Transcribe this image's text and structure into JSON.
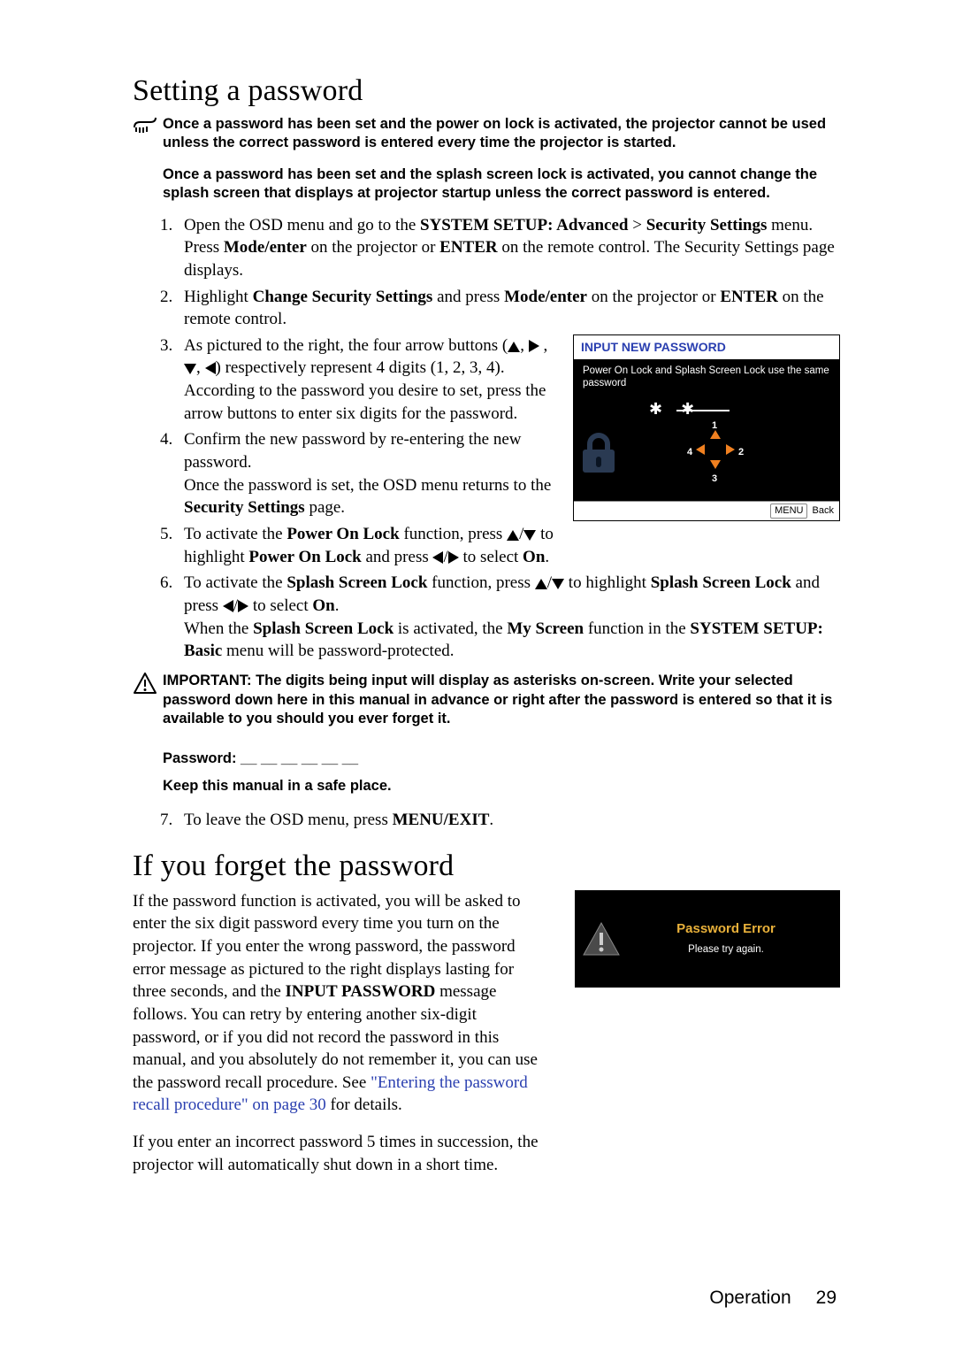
{
  "section1": {
    "title": "Setting a password",
    "notice1": "Once a password has been set and the power on lock is activated, the projector cannot be used unless the correct password is entered every time the projector is started.",
    "notice2": "Once a password has been set and the splash screen lock is activated, you cannot change the splash screen that displays at projector startup unless the correct password is entered.",
    "steps": {
      "s1": {
        "a": "Open the OSD menu and go to the ",
        "b1": "SYSTEM SETUP: Advanced",
        "gt": " > ",
        "b2": "Security Settings",
        "c": " menu. Press ",
        "b3": "Mode/enter",
        "d": " on the projector or ",
        "b4": "ENTER",
        "e": " on the remote control. The Security Settings page displays."
      },
      "s2": {
        "a": "Highlight ",
        "b1": "Change Security Settings",
        "b": " and press ",
        "b2": "Mode/enter",
        "c": " on the projector or ",
        "b3": "ENTER",
        "d": " on the remote control."
      },
      "s3": {
        "a": "As pictured to the right, the four arrow buttons (",
        "b": ") respectively represent 4 digits (1, 2, 3, 4). According to the password you desire to set, press the arrow buttons to enter six digits for the password."
      },
      "s4": {
        "a": "Confirm the new password by re-entering the new password.",
        "b": "Once the password is set, the OSD menu returns to the ",
        "c": "Security Settings",
        "d": " page."
      },
      "s5": {
        "a": "To activate the ",
        "b1": "Power On Lock",
        "b": " function, press ",
        "c": " to highlight ",
        "b2": "Power On Lock",
        "d": " and press ",
        "e": " to select ",
        "b3": "On",
        "f": "."
      },
      "s6": {
        "a": "To activate the ",
        "b1": "Splash Screen Lock",
        "b": " function, press ",
        "c": " to highlight ",
        "b2": "Splash Screen Lock",
        "d": " and press ",
        "e": " to select ",
        "b3": "On",
        "f": ".",
        "g": "When the ",
        "b4": "Splash Screen Lock",
        "h": " is activated, the ",
        "b5": "My Screen",
        "i": " function in the ",
        "b6": "SYSTEM SETUP: Basic",
        "j": " menu will be password-protected."
      }
    },
    "important": "IMPORTANT: The digits being input will display as asterisks on-screen. Write your selected password down here in this manual in advance or right after the password is entered so that it is available to you should you ever forget it.",
    "pwd_label": "Password: __ __ __ __ __ __",
    "keep": "Keep this manual in a safe place.",
    "s7": {
      "a": "To leave the OSD menu, press ",
      "b1": "MENU/EXIT",
      "b": "."
    }
  },
  "section2": {
    "title": "If you forget the password",
    "para1_a": "If the password function is activated, you will be asked to enter the six digit password every time you turn on the projector. If you enter the wrong password, the password error message as pictured to the right displays lasting for three seconds, and the ",
    "para1_b": "INPUT PASSWORD",
    "para1_c": " message follows. You can retry by entering another six-digit password, or if you did not record the password in this manual, and you absolutely do not remember it, you can use the password recall procedure. See ",
    "link": "\"Entering the password recall procedure\" on page 30",
    "para1_d": " for details.",
    "para2": "If you enter an incorrect password 5 times in succession, the projector will automatically shut down in a short time."
  },
  "osd1": {
    "title": "INPUT NEW PASSWORD",
    "subtitle": "Power On Lock and Splash Screen Lock use the same password",
    "stars": "✱ ✱",
    "d1": "1",
    "d2": "2",
    "d3": "3",
    "d4": "4",
    "menu_btn": "MENU",
    "back": "Back"
  },
  "osd2": {
    "t1": "Password Error",
    "t2": "Please try again."
  },
  "footer": {
    "section": "Operation",
    "page": "29"
  }
}
